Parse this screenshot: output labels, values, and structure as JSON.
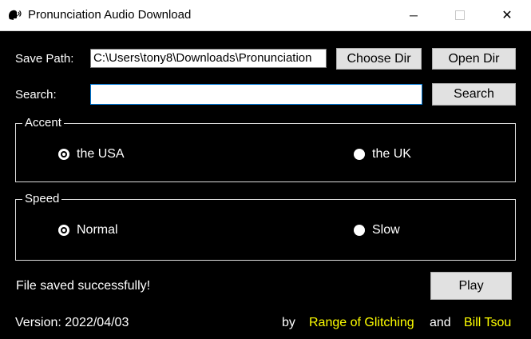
{
  "window": {
    "title": "Pronunciation Audio Download",
    "minimize": "─",
    "close": "✕"
  },
  "save_path": {
    "label": "Save Path:",
    "value": "C:\\Users\\tony8\\Downloads\\Pronunciation",
    "choose_dir": "Choose Dir",
    "open_dir": "Open Dir"
  },
  "search": {
    "label": "Search:",
    "value": "",
    "button": "Search"
  },
  "accent": {
    "title": "Accent",
    "options": [
      {
        "label": "the USA",
        "selected": true
      },
      {
        "label": "the UK",
        "selected": false
      }
    ]
  },
  "speed": {
    "title": "Speed",
    "options": [
      {
        "label": "Normal",
        "selected": true
      },
      {
        "label": "Slow",
        "selected": false
      }
    ]
  },
  "status": "File saved successfully!",
  "play_button": "Play",
  "footer": {
    "version": "Version: 2022/04/03",
    "by": "by",
    "author1": "Range of Glitching",
    "and": "and",
    "author2": "Bill Tsou"
  },
  "colors": {
    "background": "#000000",
    "author_link": "#ffff00"
  },
  "icons": {
    "app": "speaking-head-icon"
  }
}
